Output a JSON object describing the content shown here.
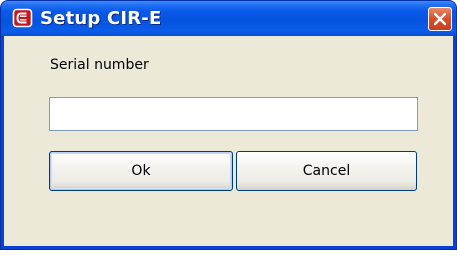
{
  "window": {
    "title": "Setup CIR-E",
    "app_icon": "cir-app-icon",
    "close_icon": "close-icon"
  },
  "form": {
    "serial_label": "Serial number",
    "serial_value": "",
    "serial_placeholder": ""
  },
  "buttons": {
    "ok_label": "Ok",
    "cancel_label": "Cancel"
  },
  "colors": {
    "titlebar": "#0554e0",
    "client_background": "#ece9d8",
    "close_button": "#d8512b",
    "input_border": "#7f9db9",
    "button_border": "#003c74"
  }
}
